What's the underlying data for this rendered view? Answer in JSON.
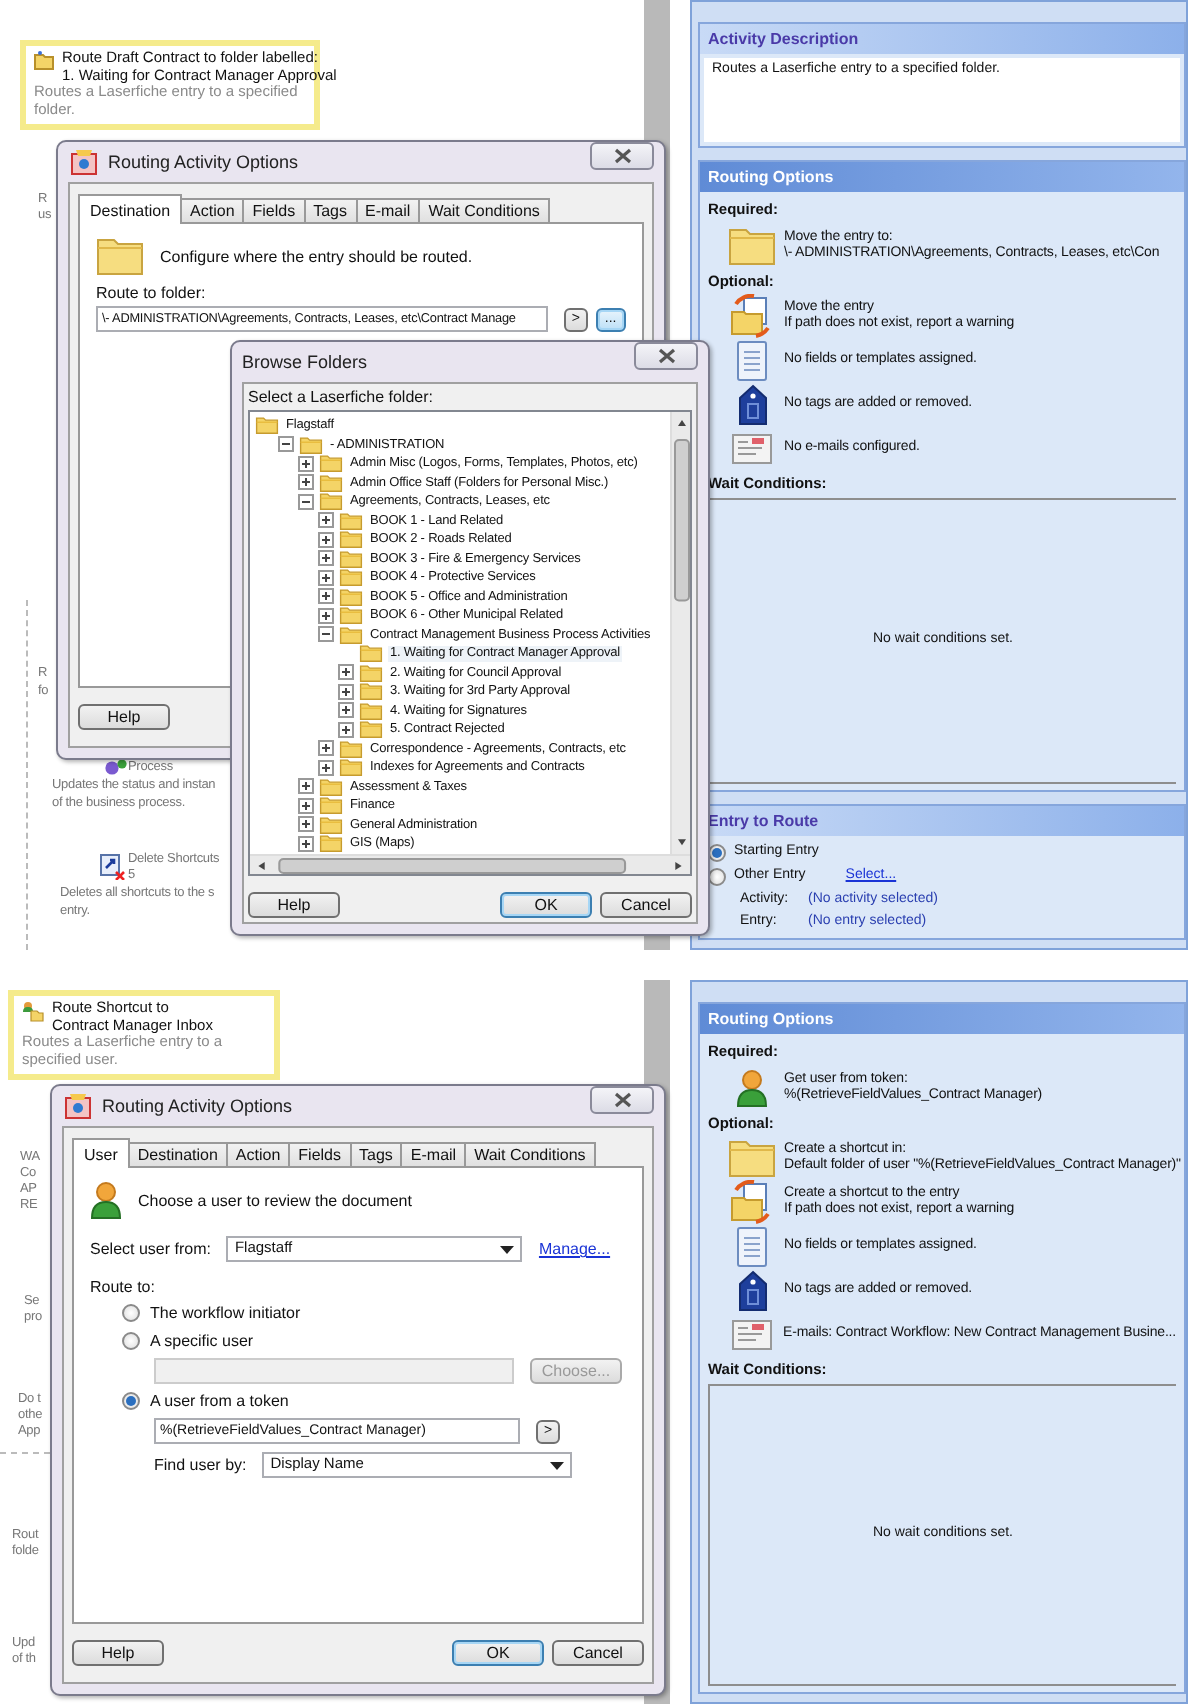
{
  "top": {
    "activity": {
      "title": [
        "Route Draft Contract to folder labelled:",
        "1. Waiting for Contract Manager Approval"
      ],
      "description": "Routes a Laserfiche entry to a specified folder."
    },
    "fragments": [
      "R",
      "us",
      "R",
      "fo",
      "Process",
      "Updates the status and instan",
      "of the business process.",
      "Delete Shortcuts",
      "5",
      "Deletes all shortcuts to the s",
      "entry."
    ],
    "dialog": {
      "kind": "destination",
      "title": "Routing Activity Options",
      "tabs": [
        {
          "label": "Destination",
          "selected": true
        },
        {
          "label": "Action",
          "selected": false
        },
        {
          "label": "Fields",
          "selected": false
        },
        {
          "label": "Tags",
          "selected": false
        },
        {
          "label": "E-mail",
          "selected": false
        },
        {
          "label": "Wait Conditions",
          "selected": false
        }
      ],
      "instruction": "Configure where the entry should be routed.",
      "route_label": "Route to folder:",
      "route_value": "\\- ADMINISTRATION\\Agreements, Contracts, Leases, etc\\Contract Manage",
      "token_button": ">",
      "browse_button": "...",
      "help_button": "Help"
    },
    "browse": {
      "title": "Browse Folders",
      "label": "Select a Laserfiche folder:",
      "buttons": [
        "Help",
        "OK",
        "Cancel"
      ],
      "tree": [
        {
          "label": "Flagstaff",
          "kind": "root",
          "selected": false,
          "children": [
            {
              "label": "- ADMINISTRATION",
              "kind": "toggle",
              "expanded": true,
              "selected": false,
              "children": [
                {
                  "label": "Admin Misc (Logos, Forms, Templates, Photos, etc)",
                  "kind": "toggle",
                  "expanded": false,
                  "selected": false
                },
                {
                  "label": "Admin Office Staff (Folders for Personal Misc.)",
                  "kind": "toggle",
                  "expanded": false,
                  "selected": false
                },
                {
                  "label": "Agreements, Contracts, Leases, etc",
                  "kind": "toggle",
                  "expanded": true,
                  "selected": false,
                  "children": [
                    {
                      "label": "BOOK 1 - Land Related",
                      "kind": "toggle",
                      "expanded": false,
                      "selected": false
                    },
                    {
                      "label": "BOOK 2 - Roads Related",
                      "kind": "toggle",
                      "expanded": false,
                      "selected": false
                    },
                    {
                      "label": "BOOK 3 - Fire & Emergency Services",
                      "kind": "toggle",
                      "expanded": false,
                      "selected": false
                    },
                    {
                      "label": "BOOK 4 - Protective Services",
                      "kind": "toggle",
                      "expanded": false,
                      "selected": false
                    },
                    {
                      "label": "BOOK 5 - Office and Administration",
                      "kind": "toggle",
                      "expanded": false,
                      "selected": false
                    },
                    {
                      "label": "BOOK 6 - Other Municipal Related",
                      "kind": "toggle",
                      "expanded": false,
                      "selected": false
                    },
                    {
                      "label": "Contract Management Business Process Activities",
                      "kind": "toggle",
                      "expanded": true,
                      "selected": false,
                      "children": [
                        {
                          "label": "1. Waiting for Contract Manager Approval",
                          "kind": "leaf",
                          "selected": true
                        },
                        {
                          "label": "2. Waiting for Council Approval",
                          "kind": "toggle",
                          "expanded": false,
                          "selected": false
                        },
                        {
                          "label": "3. Waiting for 3rd Party Approval",
                          "kind": "toggle",
                          "expanded": false,
                          "selected": false
                        },
                        {
                          "label": "4. Waiting for Signatures",
                          "kind": "toggle",
                          "expanded": false,
                          "selected": false
                        },
                        {
                          "label": "5. Contract Rejected",
                          "kind": "toggle",
                          "expanded": false,
                          "selected": false
                        }
                      ]
                    },
                    {
                      "label": "Correspondence - Agreements, Contracts, etc",
                      "kind": "toggle",
                      "expanded": false,
                      "selected": false
                    },
                    {
                      "label": "Indexes for Agreements and Contracts",
                      "kind": "toggle",
                      "expanded": false,
                      "selected": false
                    }
                  ]
                },
                {
                  "label": "Assessment & Taxes",
                  "kind": "toggle",
                  "expanded": false,
                  "selected": false
                },
                {
                  "label": "Finance",
                  "kind": "toggle",
                  "expanded": false,
                  "selected": false
                },
                {
                  "label": "General Administration",
                  "kind": "toggle",
                  "expanded": false,
                  "selected": false
                },
                {
                  "label": "GIS (Maps)",
                  "kind": "toggle",
                  "expanded": false,
                  "selected": false
                }
              ]
            }
          ]
        }
      ]
    },
    "panel": {
      "sections": [
        {
          "kind": "description",
          "title": "Activity Description",
          "text": "Routes a Laserfiche entry to a specified folder."
        },
        {
          "kind": "routing",
          "title": "Routing Options",
          "required_label": "Required:",
          "required": [
            {
              "kind": "folder",
              "lines": [
                "Move the entry to:",
                "\\- ADMINISTRATION\\Agreements, Contracts, Leases, etc\\Con"
              ]
            }
          ],
          "optional_label": "Optional:",
          "optional": [
            {
              "kind": "move",
              "lines": [
                "Move the entry",
                "If path does not exist, report a warning"
              ]
            },
            {
              "kind": "fields",
              "lines": [
                "No fields or templates assigned."
              ]
            },
            {
              "kind": "tags",
              "lines": [
                "No tags are added or removed."
              ]
            },
            {
              "kind": "email",
              "lines": [
                "No e-mails configured."
              ]
            }
          ],
          "wait_label": "Wait Conditions:",
          "wait_text": "No wait conditions set."
        },
        {
          "kind": "entry",
          "title": "Entry to Route",
          "options": [
            {
              "label": "Starting Entry",
              "selected": true
            },
            {
              "label": "Other Entry",
              "selected": false,
              "link": "Select..."
            }
          ],
          "details": [
            {
              "label": "Activity:",
              "value": "(No activity selected)"
            },
            {
              "label": "Entry:",
              "value": "(No entry selected)"
            }
          ]
        }
      ]
    }
  },
  "bottom": {
    "activity": {
      "title": [
        "Route Shortcut to",
        "Contract Manager Inbox"
      ],
      "description": "Routes a Laserfiche entry to a specified user."
    },
    "fragments": [
      "WA",
      "Co",
      "AP",
      "RE",
      "Se",
      "pro",
      "Do t",
      "othe",
      "App",
      "Rout",
      "folde",
      "Upd",
      "of th"
    ],
    "dialog": {
      "kind": "user",
      "title": "Routing Activity Options",
      "tabs": [
        {
          "label": "User",
          "selected": true
        },
        {
          "label": "Destination",
          "selected": false
        },
        {
          "label": "Action",
          "selected": false
        },
        {
          "label": "Fields",
          "selected": false
        },
        {
          "label": "Tags",
          "selected": false
        },
        {
          "label": "E-mail",
          "selected": false
        },
        {
          "label": "Wait Conditions",
          "selected": false
        }
      ],
      "instruction": "Choose a user to review the document",
      "source_label": "Select user from:",
      "source_value": "Flagstaff",
      "manage_link": "Manage...",
      "route_label": "Route to:",
      "options": [
        {
          "label": "The workflow initiator",
          "selected": false
        },
        {
          "label": "A specific user",
          "selected": false
        },
        {
          "label": "A user from a token",
          "selected": true
        }
      ],
      "choose_button": "Choose...",
      "token_value": "%(RetrieveFieldValues_Contract Manager)",
      "token_button": ">",
      "find_label": "Find user by:",
      "find_value": "Display Name",
      "help_button": "Help",
      "ok_button": "OK",
      "cancel_button": "Cancel"
    },
    "panel": {
      "sections": [
        {
          "kind": "routing",
          "title": "Routing Options",
          "required_label": "Required:",
          "required": [
            {
              "kind": "user",
              "lines": [
                "Get user from token:",
                "%(RetrieveFieldValues_Contract Manager)"
              ]
            }
          ],
          "optional_label": "Optional:",
          "optional": [
            {
              "kind": "folder",
              "lines": [
                "Create a shortcut in:",
                "Default folder of user \"%(RetrieveFieldValues_Contract Manager)\""
              ]
            },
            {
              "kind": "move",
              "lines": [
                "Create a shortcut to the entry",
                "If path does not exist, report a warning"
              ]
            },
            {
              "kind": "fields",
              "lines": [
                "No fields or templates assigned."
              ]
            },
            {
              "kind": "tags",
              "lines": [
                "No tags are added or removed."
              ]
            },
            {
              "kind": "email",
              "lines": [
                "E-mails: Contract Workflow:  New Contract Management Busine..."
              ]
            }
          ],
          "wait_label": "Wait Conditions:",
          "wait_text": "No wait conditions set."
        }
      ]
    }
  }
}
